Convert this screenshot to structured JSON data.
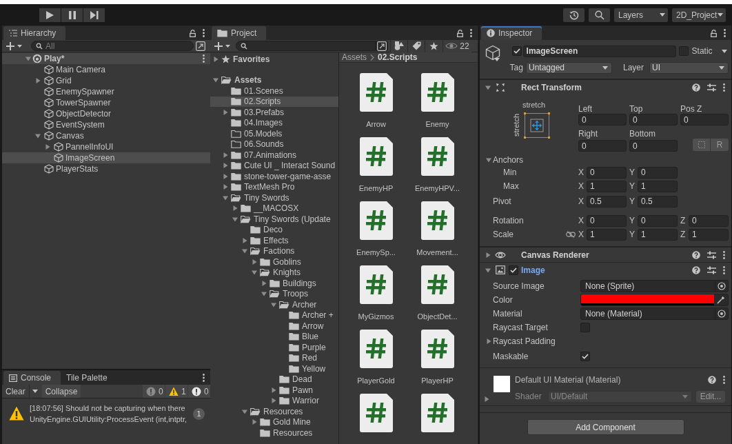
{
  "toolbar": {
    "layers": "Layers",
    "layout": "2D_Project"
  },
  "hierarchy": {
    "tab": "Hierarchy",
    "focused": false,
    "search_placeholder": "All",
    "scene": {
      "name": "Play*",
      "expanded": true
    },
    "items": [
      {
        "label": "Main Camera",
        "kind": "leaf",
        "selected": false
      },
      {
        "label": "Grid",
        "kind": "parent",
        "expanded": false,
        "selected": false
      },
      {
        "label": "EnemySpawner",
        "kind": "leaf",
        "selected": false
      },
      {
        "label": "TowerSpawner",
        "kind": "leaf",
        "selected": false
      },
      {
        "label": "ObjectDetector",
        "kind": "leaf",
        "selected": false
      },
      {
        "label": "EventSystem",
        "kind": "leaf",
        "selected": false
      },
      {
        "label": "Canvas",
        "kind": "parent",
        "expanded": true,
        "selected": false,
        "children": [
          {
            "label": "PannelInfoUI",
            "kind": "parent",
            "expanded": false,
            "selected": false
          },
          {
            "label": "ImageScreen",
            "kind": "leaf",
            "selected": true
          }
        ]
      },
      {
        "label": "PlayerStats",
        "kind": "leaf",
        "selected": false
      }
    ]
  },
  "console": {
    "tabs": [
      {
        "label": "Console",
        "selected": true
      },
      {
        "label": "Tile Palette",
        "selected": false
      }
    ],
    "clear": "Clear",
    "collapse": "Collapse",
    "counts": [
      {
        "kind": "info",
        "count": "0"
      },
      {
        "kind": "warning",
        "count": "1"
      },
      {
        "kind": "error",
        "count": "0"
      }
    ],
    "messages": [
      {
        "kind": "warning",
        "lines": [
          "[18:07:56] Should not be capturing when there",
          "UnityEngine.GUIUtility:ProcessEvent (int,intptr,"
        ],
        "count": "1"
      }
    ]
  },
  "project": {
    "tab": "Project",
    "focused": false,
    "hidden_count": "22",
    "favorites": {
      "label": "Favorites",
      "expanded": false
    },
    "tree": [
      {
        "label": "Assets",
        "kind": "parent",
        "expanded": true,
        "selected": false,
        "children": [
          {
            "label": "01.Scenes",
            "kind": "leaf",
            "selected": false
          },
          {
            "label": "02.Scripts",
            "kind": "leaf",
            "selected": true
          },
          {
            "label": "03.Prefabs",
            "kind": "parent",
            "expanded": false,
            "selected": false
          },
          {
            "label": "04.Images",
            "kind": "leaf",
            "selected": false
          },
          {
            "label": "05.Models",
            "kind": "empty",
            "selected": false
          },
          {
            "label": "06.Sounds",
            "kind": "empty",
            "selected": false
          },
          {
            "label": "07.Animations",
            "kind": "parent",
            "expanded": false,
            "selected": false
          },
          {
            "label": "Cute UI _ Interact Sound",
            "kind": "parent",
            "expanded": false,
            "selected": false
          },
          {
            "label": "stone-tower-game-asse",
            "kind": "parent",
            "expanded": false,
            "selected": false
          },
          {
            "label": "TextMesh Pro",
            "kind": "parent",
            "expanded": false,
            "selected": false
          },
          {
            "label": "Tiny Swords",
            "kind": "parent",
            "expanded": true,
            "selected": false,
            "children": [
              {
                "label": "__MACOSX",
                "kind": "parent",
                "expanded": false,
                "selected": false
              },
              {
                "label": "Tiny Swords (Update",
                "kind": "parent",
                "expanded": true,
                "selected": false,
                "children": [
                  {
                    "label": "Deco",
                    "kind": "leaf",
                    "selected": false
                  },
                  {
                    "label": "Effects",
                    "kind": "parent",
                    "expanded": false,
                    "selected": false
                  },
                  {
                    "label": "Factions",
                    "kind": "parent",
                    "expanded": true,
                    "selected": false,
                    "children": [
                      {
                        "label": "Goblins",
                        "kind": "parent",
                        "expanded": false,
                        "selected": false
                      },
                      {
                        "label": "Knights",
                        "kind": "parent",
                        "expanded": true,
                        "selected": false,
                        "children": [
                          {
                            "label": "Buildings",
                            "kind": "parent",
                            "expanded": false,
                            "selected": false
                          },
                          {
                            "label": "Troops",
                            "kind": "parent",
                            "expanded": true,
                            "selected": false,
                            "children": [
                              {
                                "label": "Archer",
                                "kind": "parent",
                                "expanded": true,
                                "selected": false,
                                "children": [
                                  {
                                    "label": "Archer +",
                                    "kind": "leaf",
                                    "selected": false
                                  },
                                  {
                                    "label": "Arrow",
                                    "kind": "leaf",
                                    "selected": false
                                  },
                                  {
                                    "label": "Blue",
                                    "kind": "leaf",
                                    "selected": false
                                  },
                                  {
                                    "label": "Purple",
                                    "kind": "leaf",
                                    "selected": false
                                  },
                                  {
                                    "label": "Red",
                                    "kind": "leaf",
                                    "selected": false
                                  },
                                  {
                                    "label": "Yellow",
                                    "kind": "leaf",
                                    "selected": false
                                  }
                                ]
                              },
                              {
                                "label": "Dead",
                                "kind": "leaf",
                                "selected": false
                              },
                              {
                                "label": "Pawn",
                                "kind": "parent",
                                "expanded": false,
                                "selected": false
                              },
                              {
                                "label": "Warrior",
                                "kind": "parent",
                                "expanded": false,
                                "selected": false
                              }
                            ]
                          }
                        ]
                      }
                    ]
                  },
                  {
                    "label": "Resources",
                    "kind": "parent",
                    "expanded": true,
                    "selected": false,
                    "children": [
                      {
                        "label": "Gold Mine",
                        "kind": "parent",
                        "expanded": false,
                        "selected": false
                      },
                      {
                        "label": "Resources",
                        "kind": "leaf",
                        "selected": false
                      }
                    ]
                  }
                ]
              }
            ]
          }
        ]
      }
    ],
    "breadcrumb": [
      "Assets",
      "02.Scripts"
    ],
    "assets": [
      {
        "kind": "script",
        "label": "Arrow"
      },
      {
        "kind": "script",
        "label": "Enemy"
      },
      {
        "kind": "script",
        "label": "EnemyHP"
      },
      {
        "kind": "script",
        "label": "EnemyHPV..."
      },
      {
        "kind": "script",
        "label": "EnemySp..."
      },
      {
        "kind": "script",
        "label": "Movement..."
      },
      {
        "kind": "script",
        "label": "MyGizmos"
      },
      {
        "kind": "script",
        "label": "ObjectDet..."
      },
      {
        "kind": "script",
        "label": "PlayerGold"
      },
      {
        "kind": "script",
        "label": "PlayerHP"
      },
      {
        "kind": "script"
      },
      {
        "kind": "script"
      }
    ]
  },
  "inspector": {
    "tab": "Inspector",
    "focused": true,
    "object": {
      "active": true,
      "name": "ImageScreen",
      "static": false,
      "static_label": "Static",
      "tag_label": "Tag",
      "tag": "Untagged",
      "layer_label": "Layer",
      "layer": "UI"
    },
    "rect_transform": {
      "title": "Rect Transform",
      "expanded": true,
      "preset_horizontal": "stretch",
      "preset_vertical": "stretch",
      "fields": [
        {
          "label": "Left",
          "value": "0"
        },
        {
          "label": "Top",
          "value": "0"
        },
        {
          "label": "Pos Z",
          "value": "0"
        },
        {
          "label": "Right",
          "value": "0"
        },
        {
          "label": "Bottom",
          "value": "0"
        }
      ],
      "raw_button": "R",
      "anchors": {
        "label": "Anchors",
        "expanded": true,
        "rows": [
          {
            "label": "Min",
            "axes": [
              {
                "axis": "X",
                "value": "0"
              },
              {
                "axis": "Y",
                "value": "0"
              }
            ]
          },
          {
            "label": "Max",
            "axes": [
              {
                "axis": "X",
                "value": "1"
              },
              {
                "axis": "Y",
                "value": "1"
              }
            ]
          }
        ]
      },
      "vectors": [
        {
          "label": "Pivot",
          "axes": [
            {
              "axis": "X",
              "value": "0.5"
            },
            {
              "axis": "Y",
              "value": "0.5"
            }
          ]
        },
        {
          "label": "Rotation",
          "axes": [
            {
              "axis": "X",
              "value": "0"
            },
            {
              "axis": "Y",
              "value": "0"
            },
            {
              "axis": "Z",
              "value": "0"
            }
          ]
        },
        {
          "label": "Scale",
          "linked": false,
          "axes": [
            {
              "axis": "X",
              "value": "1"
            },
            {
              "axis": "Y",
              "value": "1"
            },
            {
              "axis": "Z",
              "value": "1"
            }
          ]
        }
      ]
    },
    "components": [
      {
        "kind": "canvas-renderer",
        "title": "Canvas Renderer",
        "expanded": false,
        "highlighted": false
      },
      {
        "kind": "image",
        "title": "Image",
        "expanded": true,
        "enabled": true,
        "highlighted": true,
        "properties": [
          {
            "kind": "object",
            "label": "Source Image",
            "value": "None (Sprite)"
          },
          {
            "kind": "color",
            "label": "Color",
            "color": "#ff0000"
          },
          {
            "kind": "object",
            "label": "Material",
            "value": "None (Material)"
          },
          {
            "kind": "checkbox",
            "label": "Raycast Target",
            "checked": false
          },
          {
            "kind": "foldout",
            "label": "Raycast Padding",
            "expanded": false
          },
          {
            "kind": "checkbox",
            "label": "Maskable",
            "checked": true
          }
        ]
      }
    ],
    "material": {
      "name": "Default UI Material (Material)",
      "shader_label": "Shader",
      "shader": "UI/Default",
      "edit": "Edit...",
      "expanded": false
    },
    "add_component": "Add Component"
  }
}
